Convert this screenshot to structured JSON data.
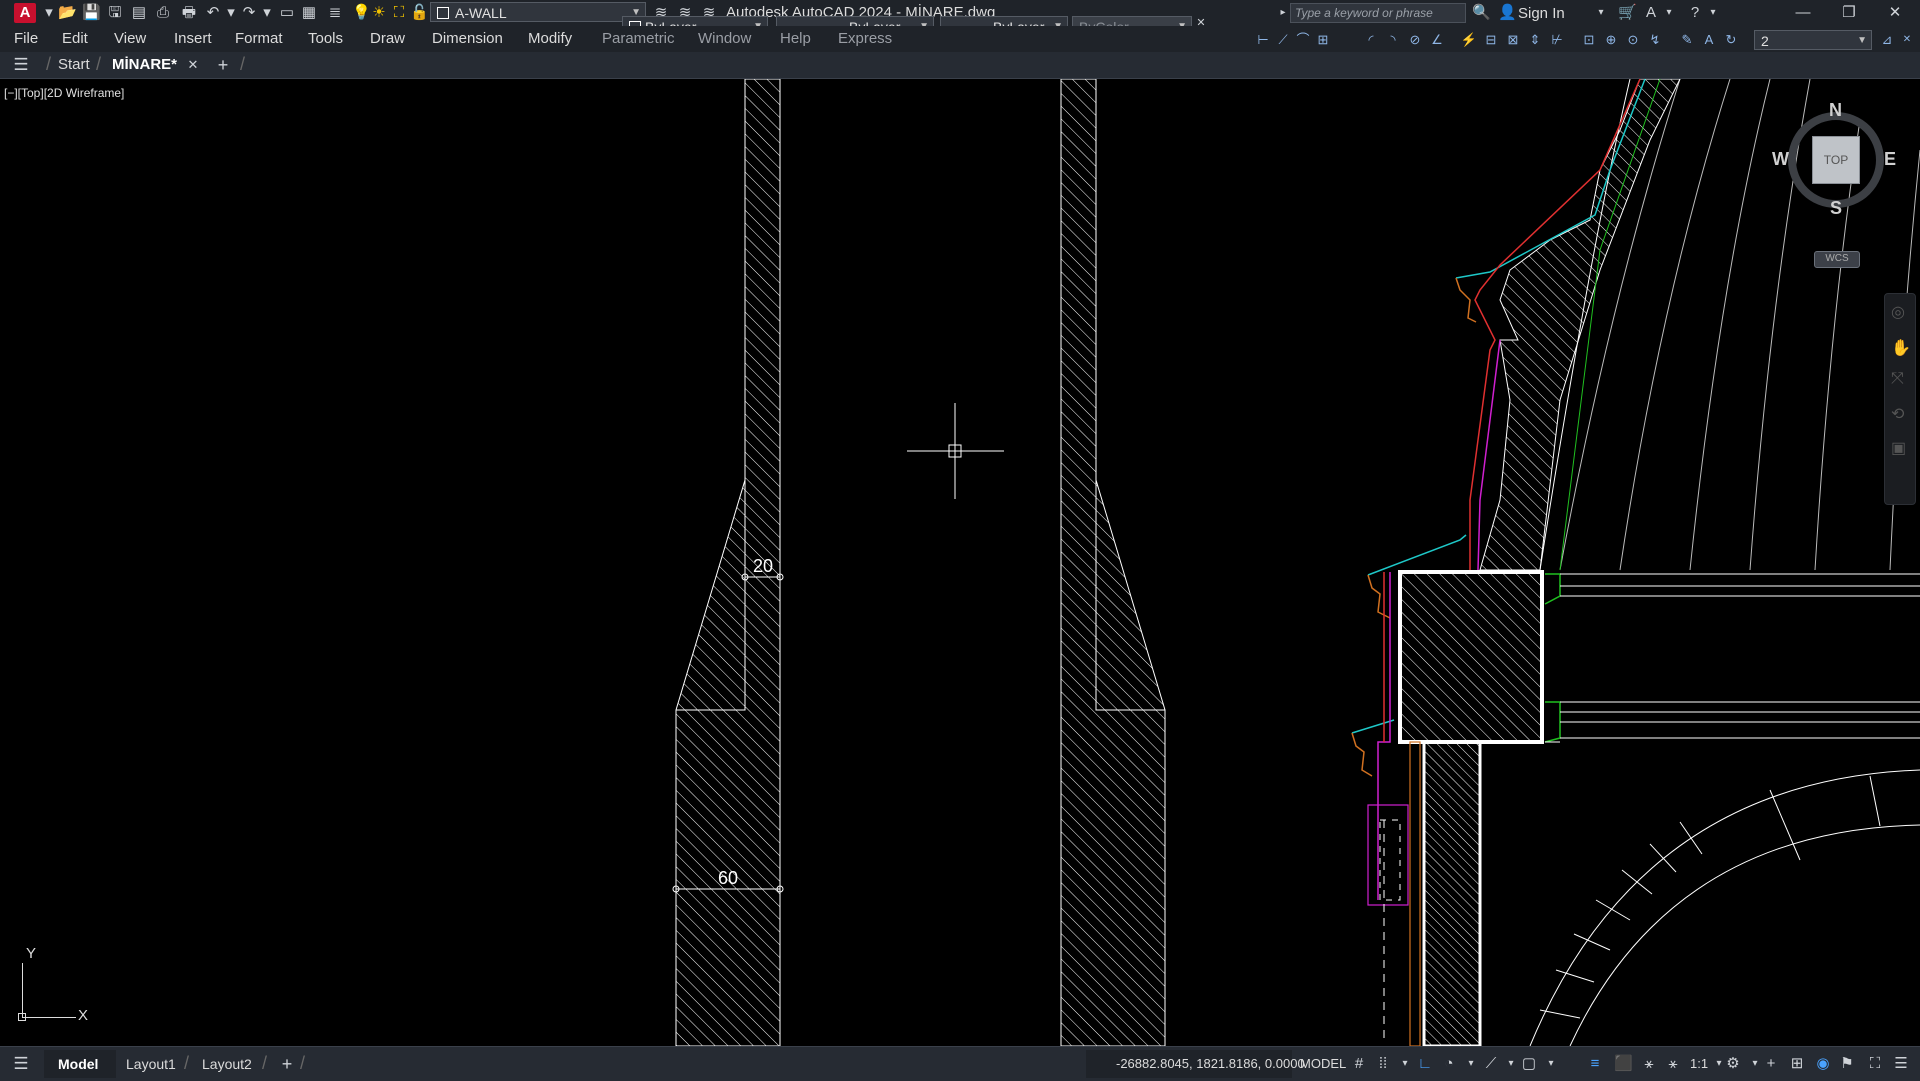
{
  "title_bar": {
    "title": "Autodesk AutoCAD 2024 - MİNARE.dwg",
    "layer_name": "A-WALL",
    "color_combo": "ByLayer",
    "linetype_combo": "ByLayer",
    "lineweight_combo": "ByLayer",
    "plotstyle_combo": "ByColor",
    "search_placeholder": "Type a keyword or phrase",
    "sign_in": "Sign In",
    "scale_value": "2"
  },
  "menu": [
    "File",
    "Edit",
    "View",
    "Insert",
    "Format",
    "Tools",
    "Draw",
    "Dimension",
    "Modify",
    "Parametric",
    "Window",
    "Help",
    "Express"
  ],
  "tabs": {
    "start": "Start",
    "drawing": "MİNARE*"
  },
  "viewport_label": "[−][Top][2D Wireframe]",
  "dimensions": {
    "top": "20",
    "bottom": "60"
  },
  "viewcube": {
    "n": "N",
    "s": "S",
    "e": "E",
    "w": "W",
    "face": "TOP",
    "wcs": "WCS"
  },
  "ucs": {
    "x": "X",
    "y": "Y"
  },
  "status": {
    "layouts": [
      "Model",
      "Layout1",
      "Layout2"
    ],
    "coords": "-26882.8045, 1821.8186, 0.0000",
    "space": "MODEL",
    "scale": "1:1"
  },
  "colors": {
    "bg": "#000000",
    "hatch": "#ffffff",
    "cyan": "#1ec8c8",
    "magenta": "#d020d0",
    "red": "#e03030",
    "green": "#20c020",
    "orange": "#d07020"
  }
}
